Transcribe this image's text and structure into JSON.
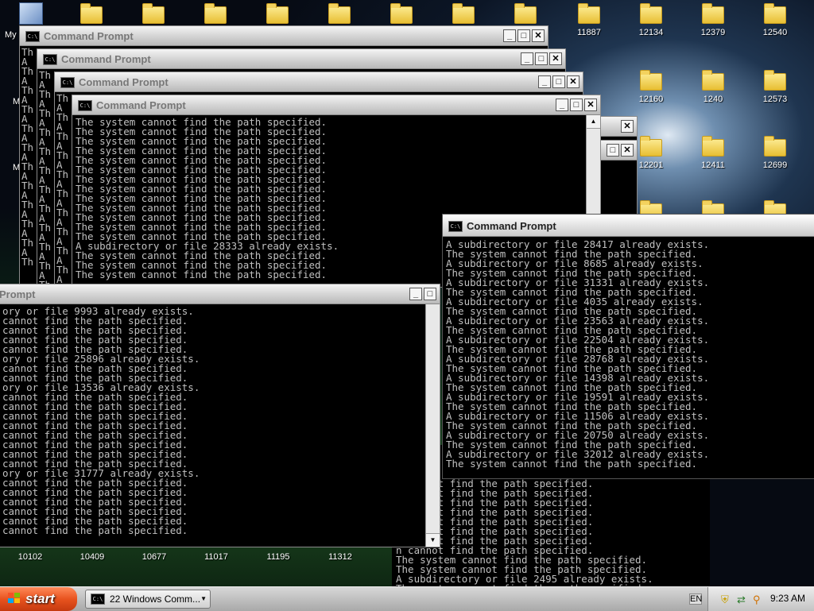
{
  "desktop": {
    "top_icons": [
      {
        "label": ""
      },
      {
        "label": ""
      },
      {
        "label": ""
      },
      {
        "label": ""
      },
      {
        "label": ""
      },
      {
        "label": ""
      },
      {
        "label": ""
      },
      {
        "label": ""
      },
      {
        "label": "11887"
      },
      {
        "label": "12134"
      },
      {
        "label": "12379"
      },
      {
        "label": "12540"
      }
    ],
    "row2_icons": [
      {
        "label": "12160"
      },
      {
        "label": "1240"
      },
      {
        "label": "12573"
      }
    ],
    "row3_icons": [
      {
        "label": "12201"
      },
      {
        "label": "12411"
      },
      {
        "label": "12699"
      }
    ],
    "bottom_labels": [
      "10102",
      "10409",
      "10677",
      "11017",
      "11195",
      "11312"
    ],
    "edge_labels": [
      "My",
      "M",
      "M"
    ]
  },
  "windows": {
    "title": "Command Prompt",
    "back_prefixes": [
      "Th",
      "A",
      "Th",
      "A",
      "Th",
      "A",
      "Th",
      "A",
      "Th",
      "A",
      "Th",
      "A",
      "Th",
      "A",
      "Th",
      "A",
      "Th",
      "A",
      "Th",
      "A",
      "Th",
      "A",
      "Th"
    ],
    "front_lines": [
      "The system cannot find the path specified.",
      "The system cannot find the path specified.",
      "The system cannot find the path specified.",
      "The system cannot find the path specified.",
      "The system cannot find the path specified.",
      "The system cannot find the path specified.",
      "The system cannot find the path specified.",
      "The system cannot find the path specified.",
      "The system cannot find the path specified.",
      "The system cannot find the path specified.",
      "The system cannot find the path specified.",
      "The system cannot find the path specified.",
      "The system cannot find the path specified.",
      "A subdirectory or file 28333 already exists.",
      "The system cannot find the path specified.",
      "The system cannot find the path specified.",
      "The system cannot find the path specified."
    ],
    "lower_left_title": "Prompt",
    "lower_left_lines": [
      "ory or file 9993 already exists.",
      "cannot find the path specified.",
      "cannot find the path specified.",
      "cannot find the path specified.",
      "cannot find the path specified.",
      "ory or file 25896 already exists.",
      "cannot find the path specified.",
      "cannot find the path specified.",
      "ory or file 13536 already exists.",
      "cannot find the path specified.",
      "cannot find the path specified.",
      "cannot find the path specified.",
      "cannot find the path specified.",
      "cannot find the path specified.",
      "cannot find the path specified.",
      "cannot find the path specified.",
      "cannot find the path specified.",
      "ory or file 31777 already exists.",
      "cannot find the path specified.",
      "cannot find the path specified.",
      "cannot find the path specified.",
      "cannot find the path specified.",
      "cannot find the path specified.",
      "cannot find the path specified."
    ],
    "active_lines": [
      "A subdirectory or file 28417 already exists.",
      "The system cannot find the path specified.",
      "A subdirectory or file 8685 already exists.",
      "The system cannot find the path specified.",
      "A subdirectory or file 31331 already exists.",
      "The system cannot find the path specified.",
      "A subdirectory or file 4035 already exists.",
      "The system cannot find the path specified.",
      "A subdirectory or file 23563 already exists.",
      "The system cannot find the path specified.",
      "A subdirectory or file 22504 already exists.",
      "The system cannot find the path specified.",
      "A subdirectory or file 28768 already exists.",
      "The system cannot find the path specified.",
      "A subdirectory or file 14398 already exists.",
      "The system cannot find the path specified.",
      "A subdirectory or file 19591 already exists.",
      "The system cannot find the path specified.",
      "A subdirectory or file 11506 already exists.",
      "The system cannot find the path specified.",
      "A subdirectory or file 20750 already exists.",
      "The system cannot find the path specified.",
      "A subdirectory or file 32012 already exists.",
      "The system cannot find the path specified."
    ],
    "behind_lines": [
      "n cannot find the path specified.",
      "n cannot find the path specified.",
      "n cannot find the path specified.",
      "n cannot find the path specified.",
      "n cannot find the path specified.",
      "n cannot find the path specified.",
      "n cannot find the path specified.",
      "n cannot find the path specified.",
      "The system cannot find the path specified.",
      "The system cannot find the path specified.",
      "A subdirectory or file 2495 already exists.",
      "The system cannot find the path specified."
    ]
  },
  "taskbar": {
    "start_label": "start",
    "task_button_label": "22 Windows Comm...",
    "language": "EN",
    "clock": "9:23 AM"
  },
  "icons": {
    "cmd_icon_text": "C:\\",
    "minimize": "_",
    "maximize": "□",
    "close": "✕",
    "scroll_up": "▲",
    "scroll_down": "▼",
    "dropdown": "▼",
    "shield": "⛨",
    "search": "⚲",
    "network": "⇄"
  },
  "colors": {
    "console_text": "#c0c0c0",
    "console_bg": "#000000",
    "start_button": "#e8531f"
  }
}
